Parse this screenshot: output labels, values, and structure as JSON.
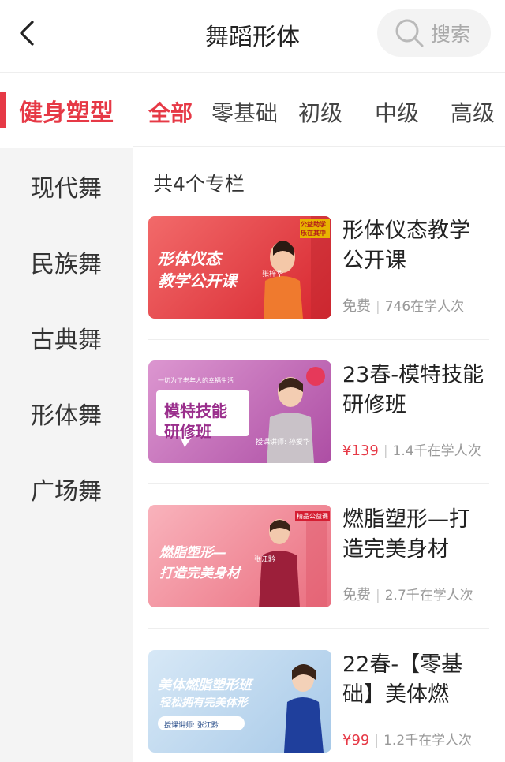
{
  "header": {
    "title": "舞蹈形体",
    "search_label": "搜索"
  },
  "sidebar": {
    "items": [
      {
        "label": "健身塑型",
        "active": true
      },
      {
        "label": "现代舞"
      },
      {
        "label": "民族舞"
      },
      {
        "label": "古典舞"
      },
      {
        "label": "形体舞"
      },
      {
        "label": "广场舞"
      }
    ]
  },
  "tabs": [
    {
      "label": "全部",
      "active": true
    },
    {
      "label": "零基础"
    },
    {
      "label": "初级"
    },
    {
      "label": "中级"
    },
    {
      "label": "高级"
    }
  ],
  "count_text": "共4个专栏",
  "courses": [
    {
      "title": "形体仪态教学公开课",
      "price": "免费",
      "learners": "746在学人次",
      "thumb_line1": "形体仪态",
      "thumb_line2": "教学公开课",
      "teacher": "张梓华",
      "badge": "公益助学 乐在其中",
      "colors": [
        "#f0555a",
        "#d82c34"
      ]
    },
    {
      "title": "23春-模特技能研修班",
      "price": "¥139",
      "learners": "1.4千在学人次",
      "thumb_line1": "模特技能",
      "thumb_line2": "研修班",
      "thumb_top": "一切为了老年人的幸福生活",
      "teacher": "授课讲师: 孙爱华",
      "colors": [
        "#d58bc9",
        "#b156a8"
      ]
    },
    {
      "title": "燃脂塑形—打造完美身材",
      "price": "免费",
      "learners": "2.7千在学人次",
      "thumb_line1": "燃脂塑形—",
      "thumb_line2": "打造完美身材",
      "teacher": "张江黔",
      "badge": "精品公益课",
      "colors": [
        "#f7a8b2",
        "#e86f7e"
      ]
    },
    {
      "title": "22春-【零基础】美体燃脂...",
      "price": "¥99",
      "learners": "1.2千在学人次",
      "thumb_line1": "美体燃脂塑形班",
      "thumb_line2": "轻松拥有完美体形",
      "teacher": "授课讲师: 张江黔",
      "colors": [
        "#cfe2f3",
        "#9fc4e6"
      ]
    }
  ]
}
